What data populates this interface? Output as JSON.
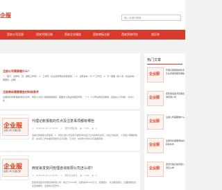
{
  "header": {
    "logo": "企服",
    "search_placeholder": "输入关键词搜索..."
  },
  "nav": [
    "西安公司注册",
    "西安代理记账",
    "西安企业服务",
    "西安商标注册",
    "西安资质代办",
    "首页本"
  ],
  "notices": [
    {
      "title": "注册公司需要缴什么？",
      "text": "一、银行：法律有，另，报税工作间）：1、工商局（企业名称预先核准通知）；2、注册资本：3个个工作日；3、不一需要《私人条，投资资本，需要签...主要）..."
    },
    {
      "title": "注册商标需要哪些材料和条件",
      "text": "注册商标所需准备材料及条件：申请人为法人或者其他组织，需要法人营业执照复印件；（一）个人申请商标注册的，应提交以下材料：（中文）条..."
    }
  ],
  "articles": [
    {
      "thumb": "企业服",
      "thumb_sub": "注册公司·代理记账",
      "title": "代理记账报税的优点及注意事项都有哪些",
      "date": "2020-06-15 12:55:59",
      "category": "西安代理记账",
      "views": "3405",
      "comments": "0",
      "excerpt": "选择记账报税注意事项：1、有些记账公司没有与委托单位签订正式的委托合同，对双方的权利、义务缺少明确的规定，在实际工作中遇到原始凭证不完整、不合法，在财务分析时只有票面原始..."
    },
    {
      "thumb": "企业服",
      "thumb_sub": "注册公司·代理记账",
      "title": "西安染发变问管理咨询有限公司怎么样？",
      "date": "2020-06-15 12:55:59",
      "category": "西安企业服务",
      "views": "3405",
      "comments": "0",
      "excerpt": "西安染发变问管理咨询有限公司，成立于2016年，注册资本1000万元，管理团队、专业服务团队、全面细致的企业咨询服务，注册地点西安市..."
    }
  ],
  "sidebar": {
    "heading": "热门文章",
    "items": [
      {
        "thumb": "企业服",
        "label": "代理记账报税的优点及注意事项都有哪些"
      },
      {
        "thumb": "企业服",
        "label": "西安染发变问管理咨询有限公司"
      },
      {
        "thumb": "企业服",
        "label": "注册公司需要缴什么"
      },
      {
        "thumb": "企业服",
        "label": "注册商标需要哪些材料和条件"
      },
      {
        "thumb": "企业服",
        "label": "西安代理记账有限公司怎么样"
      }
    ]
  },
  "colors": {
    "brand": "#d83a2c",
    "background": "#f2f2f2"
  }
}
